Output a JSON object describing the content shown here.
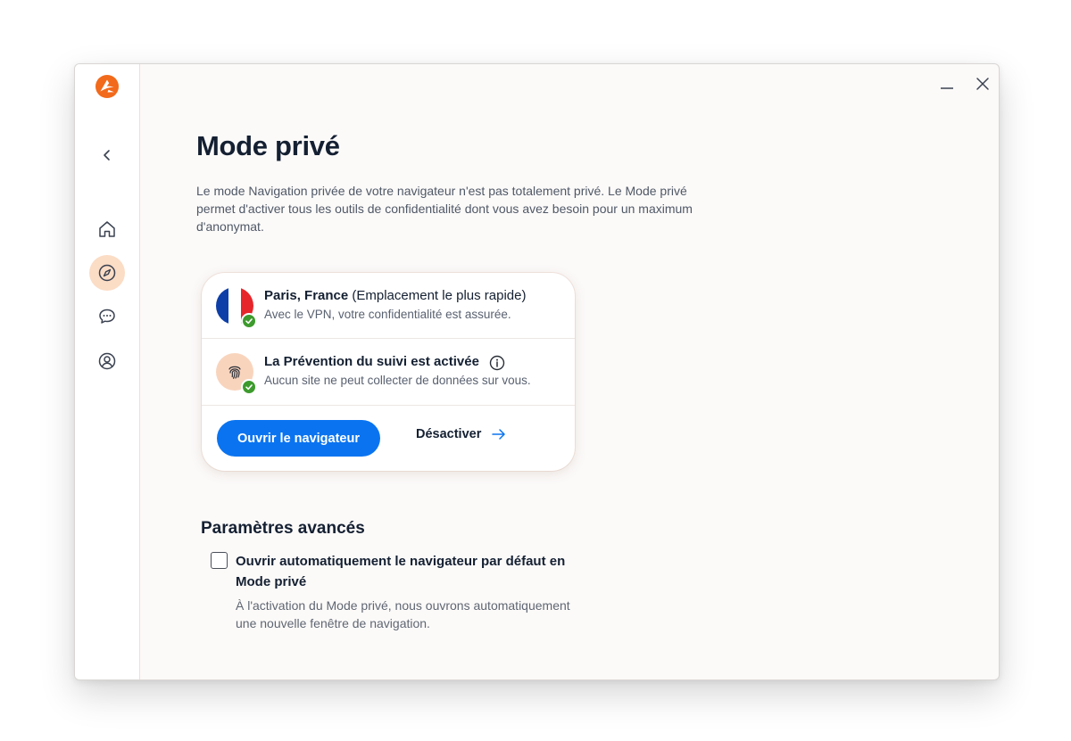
{
  "app": {
    "accent_color": "#f26a1b",
    "logo_icon": "avast-logo-icon"
  },
  "sidebar": {
    "items": [
      {
        "name": "back",
        "icon": "chevron-left-icon"
      },
      {
        "name": "home",
        "icon": "home-icon"
      },
      {
        "name": "explore",
        "icon": "compass-icon",
        "active": true
      },
      {
        "name": "chat",
        "icon": "chat-bubble-icon"
      },
      {
        "name": "account",
        "icon": "user-circle-icon"
      }
    ]
  },
  "window_controls": {
    "minimize": "—",
    "close": "✕"
  },
  "page": {
    "title": "Mode privé",
    "description": "Le mode Navigation privée de votre navigateur n'est pas totalement privé. Le Mode privé permet d'activer tous les outils de confidentialité dont vous avez besoin pour un maximum d'anonymat."
  },
  "card": {
    "vpn": {
      "location_bold": "Paris, France",
      "location_extra": " (Emplacement le plus rapide)",
      "subtitle": "Avec le VPN, votre confidentialité est assurée."
    },
    "tracking": {
      "title": "La Prévention du suivi est activée",
      "subtitle": "Aucun site ne peut collecter de données sur vous."
    },
    "actions": {
      "open_browser": "Ouvrir le navigateur",
      "deactivate": "Désactiver"
    }
  },
  "advanced": {
    "title": "Paramètres avancés",
    "option": {
      "checked": false,
      "label": "Ouvrir automatiquement le navigateur par défaut en Mode privé",
      "description": "À l'activation du Mode privé, nous ouvrons automatiquement une nouvelle fenêtre de navigation."
    }
  },
  "colors": {
    "primary_button": "#0a74f0",
    "active_nav_bg": "#fbdcc5",
    "success_check": "#3d9b2d",
    "flag_blue": "#0e3fa8",
    "flag_white": "#ffffff",
    "flag_red": "#e6262b"
  }
}
